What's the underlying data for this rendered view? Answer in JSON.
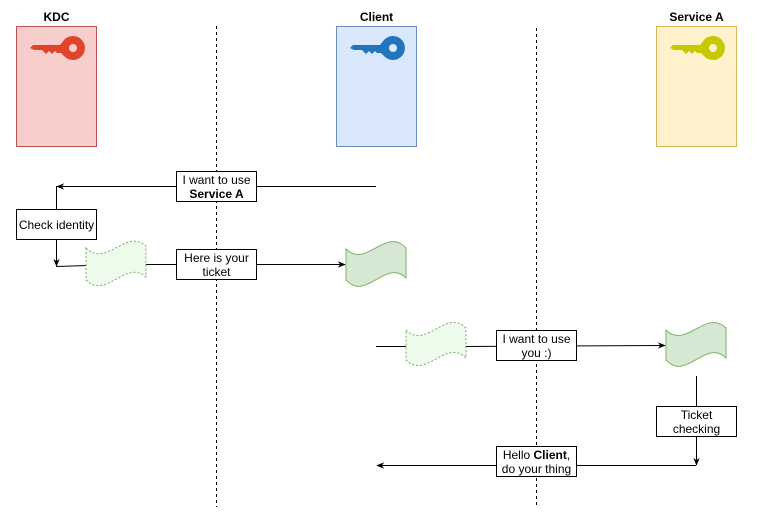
{
  "actors": [
    {
      "id": "kdc",
      "name": "KDC",
      "fill": "#f8cecc",
      "stroke": "#b85450",
      "key_color": "#e0442b"
    },
    {
      "id": "client",
      "name": "Client",
      "fill": "#dae8fc",
      "stroke": "#6c8ebf",
      "key_color": "#2275bb"
    },
    {
      "id": "service",
      "name": "Service A",
      "fill": "#fff2cc",
      "stroke": "#d6b656",
      "key_color": "#c8c800"
    }
  ],
  "messages": {
    "request": {
      "line1": "I want to use",
      "line2_bold": "Service A"
    },
    "check": {
      "text": "Check identity"
    },
    "ticket": {
      "line1": "Here is your",
      "line2": "ticket"
    },
    "use": {
      "line1": "I want to use",
      "line2": "you :)"
    },
    "ticket_check": {
      "line1": "Ticket",
      "line2": "checking"
    },
    "reply": {
      "pre": "Hello ",
      "bold": "Client",
      "post": ",",
      "line2": "do your thing"
    }
  },
  "colors": {
    "ticket_fill": "#d5e8d4",
    "ticket_stroke": "#82b366",
    "ticket_ghost_fill": "#ecfbea",
    "ticket_ghost_stroke": "#7aa870",
    "line": "#000000"
  }
}
